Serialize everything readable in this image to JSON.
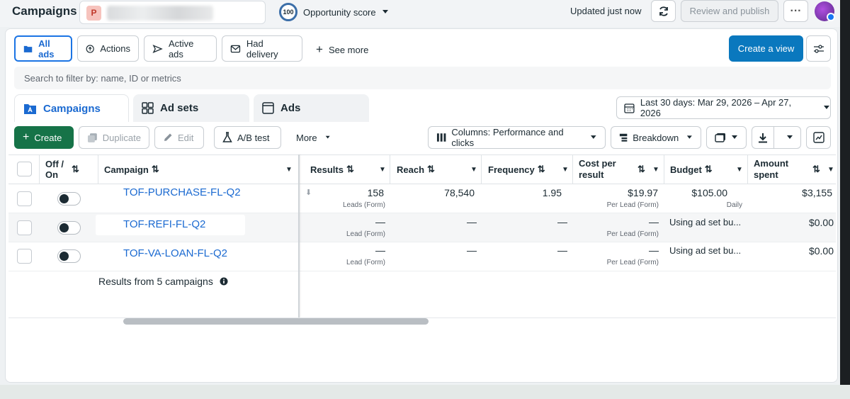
{
  "header": {
    "title": "Campaigns",
    "account_initial": "P",
    "opportunity": {
      "score": "100",
      "label": "Opportunity score"
    },
    "updated": "Updated just now",
    "review_label": "Review and publish",
    "more_label": "···"
  },
  "filters": {
    "all_ads": "All ads",
    "actions": "Actions",
    "active_ads": "Active ads",
    "had_delivery": "Had delivery",
    "see_more": "See more",
    "create_view": "Create a view"
  },
  "search": {
    "placeholder": "Search to filter by: name, ID or metrics"
  },
  "tabs": {
    "campaigns": "Campaigns",
    "ad_sets": "Ad sets",
    "ads": "Ads"
  },
  "date_range": "Last 30 days: Mar 29, 2026 – Apr 27, 2026",
  "toolbar": {
    "create": "Create",
    "duplicate": "Duplicate",
    "edit": "Edit",
    "ab_test": "A/B test",
    "more": "More",
    "columns": "Columns: Performance and clicks",
    "breakdown": "Breakdown"
  },
  "table": {
    "headers": {
      "offon": "Off / On",
      "campaign": "Campaign",
      "results": "Results",
      "reach": "Reach",
      "frequency": "Frequency",
      "cost": "Cost per result",
      "budget": "Budget",
      "amount": "Amount spent"
    },
    "rows": [
      {
        "name": "TOF-PURCHASE-FL-Q2",
        "results": "158",
        "results_sub": "Leads (Form)",
        "reach": "78,540",
        "frequency": "1.95",
        "cost": "$19.97",
        "cost_sub": "Per Lead (Form)",
        "budget": "$105.00",
        "budget_sub": "Daily",
        "spent": "$3,155"
      },
      {
        "name": "TOF-REFI-FL-Q2",
        "results": "—",
        "results_sub": "Lead (Form)",
        "reach": "—",
        "frequency": "—",
        "cost": "—",
        "cost_sub": "Per Lead (Form)",
        "budget": "Using ad set bu...",
        "spent": "$0.00"
      },
      {
        "name": "TOF-VA-LOAN-FL-Q2",
        "results": "—",
        "results_sub": "Lead (Form)",
        "reach": "—",
        "frequency": "—",
        "cost": "—",
        "cost_sub": "Per Lead (Form)",
        "budget": "Using ad set bu...",
        "spent": "$0.00"
      }
    ],
    "footer": "Results from 5 campaigns"
  }
}
